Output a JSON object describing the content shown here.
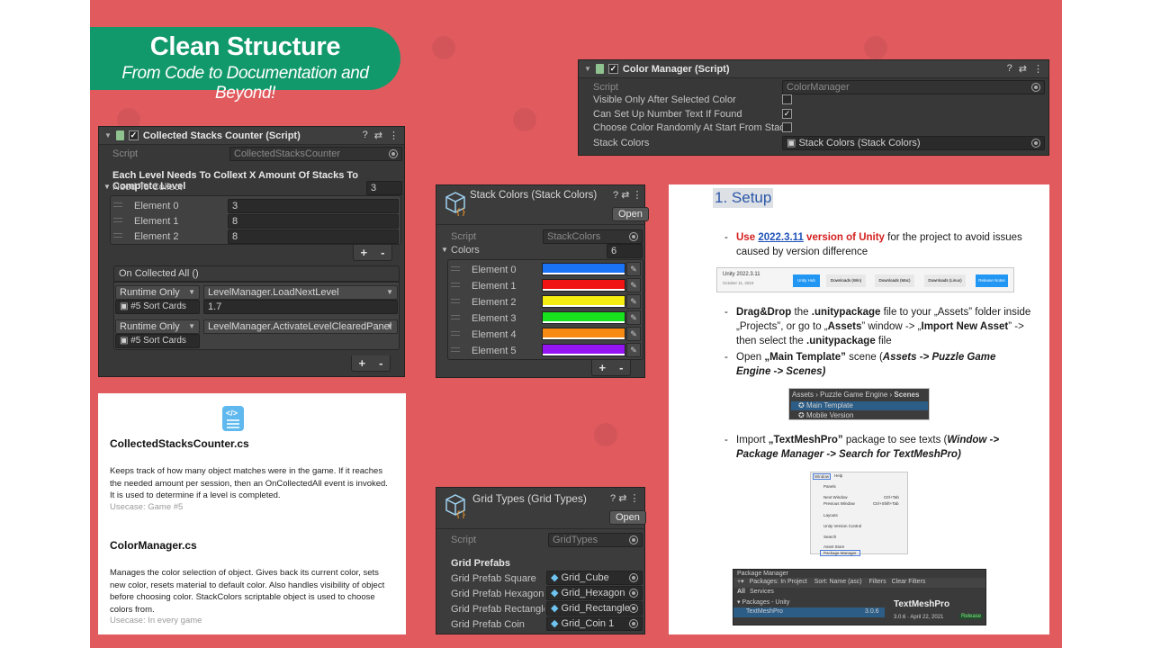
{
  "banner": {
    "title": "Clean Structure",
    "subtitle": "From Code to Documentation and Beyond!"
  },
  "colors": {
    "background": "#e05a5e",
    "banner": "#12996b",
    "inspector": "#383838"
  },
  "stacks_counter": {
    "title": "Collected Stacks Counter (Script)",
    "script_label": "Script",
    "script_value": "CollectedStacksCounter",
    "info": "Each Level Needs To Collext X Amount Of Stacks To Complete Level",
    "need_label": "Need To Collect",
    "need_count": "3",
    "elements": [
      {
        "label": "Element 0",
        "value": "3"
      },
      {
        "label": "Element 1",
        "value": "8"
      },
      {
        "label": "Element 2",
        "value": "8"
      }
    ],
    "event_label": "On Collected All ()",
    "events": [
      {
        "mode": "Runtime Only",
        "method": "LevelManager.LoadNextLevel",
        "target": "#5 Sort Cards",
        "arg": "1.7"
      },
      {
        "mode": "Runtime Only",
        "method": "LevelManager.ActivateLevelClearedPanel",
        "target": "#5 Sort Cards",
        "arg": ""
      }
    ],
    "plus": "+",
    "minus": "-"
  },
  "color_manager": {
    "title": "Color Manager (Script)",
    "script_label": "Script",
    "script_value": "ColorManager",
    "props": [
      {
        "label": "Visible Only After Selected Color",
        "checked": false
      },
      {
        "label": "Can Set Up Number Text If Found",
        "checked": true
      },
      {
        "label": "Choose Color Randomly At Start From Stack",
        "checked": false
      }
    ],
    "stack_label": "Stack Colors",
    "stack_value": "Stack Colors (Stack Colors)"
  },
  "stack_colors": {
    "title": "Stack Colors (Stack Colors)",
    "open": "Open",
    "script_label": "Script",
    "script_value": "StackColors",
    "colors_label": "Colors",
    "count": "6",
    "elements": [
      {
        "label": "Element 0",
        "color": "#1a72f5"
      },
      {
        "label": "Element 1",
        "color": "#f01414"
      },
      {
        "label": "Element 2",
        "color": "#f5ec10"
      },
      {
        "label": "Element 3",
        "color": "#18e21e"
      },
      {
        "label": "Element 4",
        "color": "#f78a12"
      },
      {
        "label": "Element 5",
        "color": "#9414f2"
      }
    ],
    "plus": "+",
    "minus": "-"
  },
  "grid_types": {
    "title": "Grid Types (Grid Types)",
    "open": "Open",
    "script_label": "Script",
    "script_value": "GridTypes",
    "section": "Grid Prefabs",
    "rows": [
      {
        "label": "Grid Prefab Square",
        "value": "Grid_Cube"
      },
      {
        "label": "Grid Prefab Hexagon",
        "value": "Grid_Hexagon"
      },
      {
        "label": "Grid Prefab Rectangle",
        "value": "Grid_Rectangle"
      },
      {
        "label": "Grid Prefab Coin",
        "value": "Grid_Coin 1"
      }
    ]
  },
  "doc_card": {
    "icon": "</>",
    "title1": "CollectedStacksCounter.cs",
    "body1": "Keeps track of how many object matches were in the game. If it reaches the needed amount per session, then an OnCollectedAll event is invoked. It is used to determine if a level is completed.",
    "use1": "Usecase: Game #5",
    "title2": "ColorManager.cs",
    "body2": "Manages the color selection of object. Gives back its current color, sets new color, resets material to default color. Also handles visibility of object before choosing color. StackColors scriptable object is used to choose colors from.",
    "use2": "Usecase: In every game"
  },
  "setup": {
    "heading": "1. Setup",
    "bullet": "-",
    "s1_use": "Use",
    "s1_version": "2022.3.11",
    "s1_unity": "version of Unity",
    "s1_rest": "for the project to avoid issues caused by version difference",
    "unity_bar": {
      "version": "Unity 2022.3.11",
      "date": "October 11, 2023",
      "hub": "Unity Hub",
      "win": "Downloads (Win)",
      "mac": "Downloads (Mac)",
      "linux": "Downloads (Linux)",
      "notes": "Release Notes"
    },
    "s2_a": "Drag&Drop",
    "s2_b": "the",
    "s2_c": ".unitypackage",
    "s2_d": "file to your „Assets” folder inside „Projects”, or go to „",
    "s2_e": "Assets",
    "s2_f": "” window -> „",
    "s2_g": "Import New Asset",
    "s2_h": "” -> then select the",
    "s2_i": ".unitypackage",
    "s2_j": "file",
    "s3_a": "Open",
    "s3_b": "„Main Template”",
    "s3_c": "scene (",
    "s3_d": "Assets -> Puzzle Game Engine -> Scenes)",
    "proj": {
      "path1": "Assets",
      "path2": "Puzzle Game Engine",
      "path3": "Scenes",
      "item1": "Main Template",
      "item2": "Mobile Version"
    },
    "s4_a": "Import",
    "s4_b": "„TextMeshPro”",
    "s4_c": "package to see texts (",
    "s4_d": "Window    -> Package Manager -> Search for TextMeshPro)",
    "menu": {
      "window": "Window",
      "help": "Help",
      "items": [
        "Panels",
        "Next Window",
        "Previous Window",
        "Layouts",
        "Unity Version Control",
        "Search",
        "Asset Store",
        "Package Manager"
      ],
      "short1": "Ctrl+Tab",
      "short2": "Ctrl+Shift+Tab"
    },
    "pm": {
      "title": "Package Manager",
      "in_project": "Packages: In Project",
      "sort": "Sort: Name (asc)",
      "filters": "Filters",
      "clear": "Clear Filters",
      "all": "All",
      "services": "Services",
      "group": "Packages - Unity",
      "pkg": "TextMeshPro",
      "ver": "3.0.6",
      "name": "TextMeshPro",
      "info": "3.0.6 · April 22, 2021",
      "release": "Release"
    }
  }
}
